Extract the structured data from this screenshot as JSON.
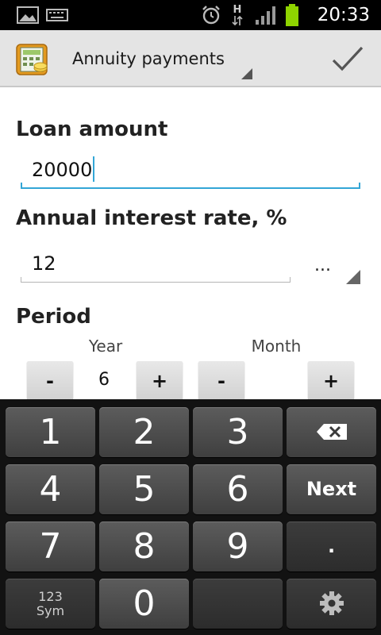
{
  "status_bar": {
    "time": "20:33",
    "network_label": "H",
    "icons": [
      "gallery-icon",
      "keyboard-icon",
      "alarm-icon",
      "data-transfer-icon",
      "signal-icon",
      "battery-icon"
    ]
  },
  "action_bar": {
    "title": "Annuity payments",
    "confirm_icon": "check-icon"
  },
  "form": {
    "loan_amount_label": "Loan amount",
    "loan_amount_value": "20000",
    "interest_label": "Annual interest rate, %",
    "interest_value": "12",
    "interest_spinner_text": "...",
    "period_label": "Period",
    "year_label": "Year",
    "year_value": "6",
    "month_label": "Month",
    "month_value": "",
    "minus": "-",
    "plus": "+"
  },
  "keyboard": {
    "k1": "1",
    "k2": "2",
    "k3": "3",
    "k4": "4",
    "k5": "5",
    "k6": "6",
    "k7": "7",
    "k8": "8",
    "k9": "9",
    "k0": "0",
    "next": "Next",
    "dot": ".",
    "sym_line1": "123",
    "sym_line2": "Sym",
    "backspace_icon": "backspace-icon",
    "settings_icon": "gear-icon"
  },
  "colors": {
    "accent": "#33a6d6",
    "battery": "#8fd400",
    "keyboard_bg": "#121212"
  }
}
